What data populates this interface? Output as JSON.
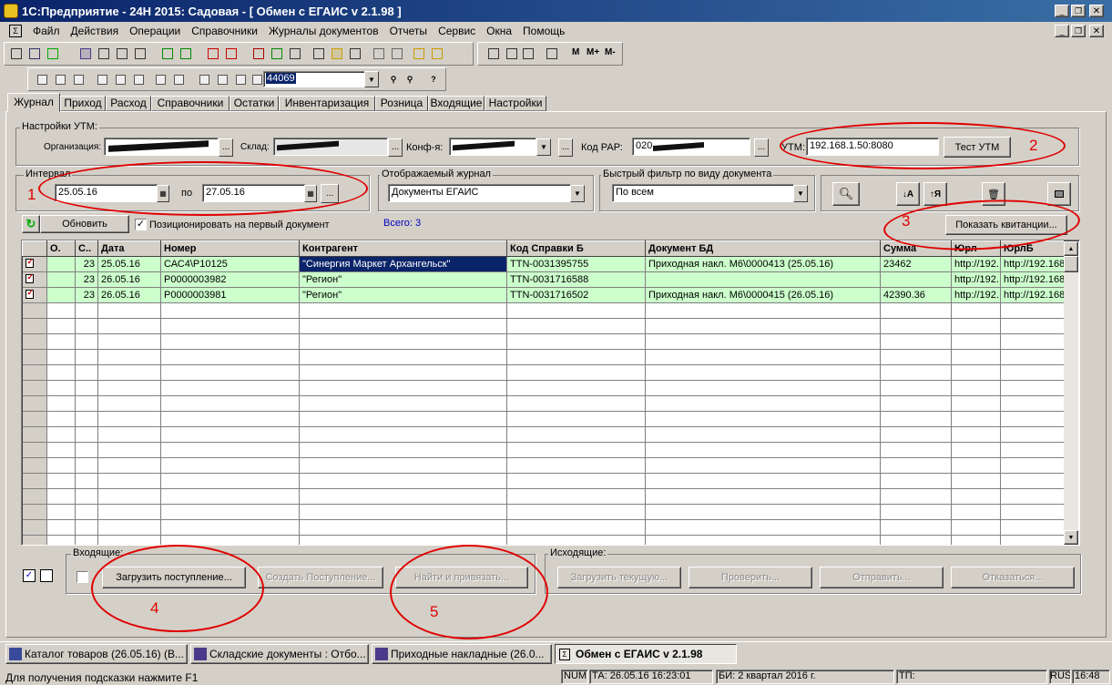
{
  "window": {
    "title": "1С:Предприятие - 24Н 2015: Садовая - [ Обмен с ЕГАИС  v 2.1.98 ]"
  },
  "menu": [
    "Файл",
    "Действия",
    "Операции",
    "Справочники",
    "Журналы документов",
    "Отчеты",
    "Сервис",
    "Окна",
    "Помощь"
  ],
  "toolbar": {
    "search_value": "44069",
    "m_buttons": [
      "M",
      "M+",
      "M-"
    ]
  },
  "tabs": [
    "Журнал",
    "Приход",
    "Расход",
    "Справочники",
    "Остатки",
    "Инвентаризация",
    "Розница",
    "Входящие",
    "Настройки"
  ],
  "utm": {
    "group_title": "Настройки УТМ:",
    "org_label": "Организация:",
    "warehouse_label": "Склад:",
    "conf_label": "Конф-я:",
    "rar_label": "Код РАР:",
    "rar_value": "020",
    "utm_label": "УТМ:",
    "utm_value": "192.168.1.50:8080",
    "test_button": "Тест УТМ"
  },
  "interval": {
    "title": "Интервал",
    "from": "25.05.16",
    "to_label": "по",
    "to": "27.05.16"
  },
  "journal": {
    "title": "Отображаемый журнал",
    "value": "Документы ЕГАИС"
  },
  "filter": {
    "title": "Быстрый фильтр по виду документа",
    "value": "По всем"
  },
  "refresh_button": "Обновить",
  "position_checkbox": "Позиционировать на первый документ",
  "total": "Всего: 3",
  "show_receipts_button": "Показать квитанции...",
  "table": {
    "headers": [
      "",
      "О.",
      "С..",
      "Дата",
      "Номер",
      "Контрагент",
      "Код Справки Б",
      "Документ БД",
      "Сумма",
      "Юрл",
      "ЮрлБ"
    ],
    "rows": [
      {
        "c": "23",
        "date": "25.05.16",
        "num": "САС4\\Р10125",
        "partner": "\"Синергия Маркет Архангельск\"",
        "code": "TTN-0031395755",
        "doc": "Приходная накл. М6\\0000413 (25.05.16)",
        "sum": "23462",
        "url": "http://192.",
        "url2": "http://192.168"
      },
      {
        "c": "23",
        "date": "26.05.16",
        "num": "Р0000003982",
        "partner": "\"Регион\"",
        "code": "TTN-0031716588",
        "doc": "",
        "sum": "",
        "url": "http://192.",
        "url2": "http://192.168"
      },
      {
        "c": "23",
        "date": "26.05.16",
        "num": "Р0000003981",
        "partner": "\"Регион\"",
        "code": "TTN-0031716502",
        "doc": "Приходная накл. М6\\0000415 (26.05.16)",
        "sum": "42390.36",
        "url": "http://192.",
        "url2": "http://192.168"
      }
    ]
  },
  "incoming": {
    "title": "Входящие:",
    "load_button": "Загрузить поступление...",
    "create_button": "Создать Поступление...",
    "find_button": "Найти и привязать..."
  },
  "outgoing": {
    "title": "Исходящие:",
    "load_current": "Загрузить текущую...",
    "check": "Проверить...",
    "send": "Отправить...",
    "reject": "Отказаться..."
  },
  "annotations": [
    "1",
    "2",
    "3",
    "4",
    "5"
  ],
  "taskbar": [
    "Каталог товаров (26.05.16) (В...",
    "Складские документы : Отбо...",
    "Приходные накладные (26.0...",
    "Обмен с ЕГАИС  v 2.1.98"
  ],
  "statusbar": {
    "hint": "Для получения подсказки нажмите F1",
    "num": "NUM",
    "ta": "ТА: 26.05.16  16:23:01",
    "bi": "БИ: 2 квартал 2016 г.",
    "tp": "ТП:",
    "lang": "RUS",
    "time": "16:48"
  },
  "colors": {
    "title_bar": "#0a246a",
    "row_green": "#ccffcc",
    "annotation": "#e00000"
  }
}
